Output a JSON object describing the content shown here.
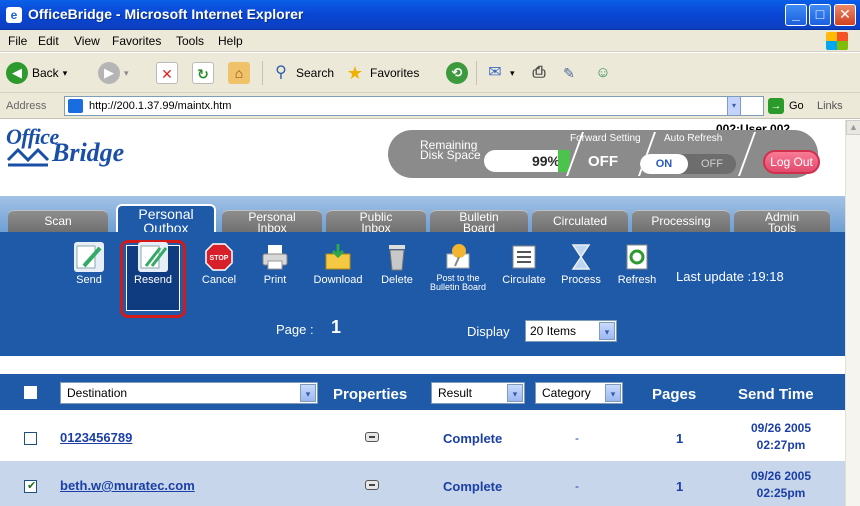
{
  "window": {
    "title": "OfficeBridge - Microsoft Internet Explorer",
    "min_glyph": "_",
    "max_glyph": "□",
    "close_glyph": "✕",
    "app_icon": "e"
  },
  "menu": {
    "items": [
      "File",
      "Edit",
      "View",
      "Favorites",
      "Tools",
      "Help"
    ]
  },
  "toolbar": {
    "back_label": "Back",
    "search_label": "Search",
    "favorites_label": "Favorites",
    "dropdown_glyph": "▾"
  },
  "address": {
    "label": "Address",
    "url": "http://200.1.37.99/maintx.htm",
    "go_label": "Go",
    "links_label": "Links"
  },
  "header": {
    "logo_office": "Office",
    "logo_bridge": "Bridge",
    "user": "002:User 002",
    "remaining_disk_space_label_1": "Remaining",
    "remaining_disk_space_label_2": "Disk Space",
    "disk_percent": "99%",
    "forward_setting_label": "Forward Setting",
    "forward_setting_value": "OFF",
    "auto_refresh_label": "Auto Refresh",
    "auto_refresh_on": "ON",
    "auto_refresh_off": "OFF",
    "logout_label": "Log Out"
  },
  "tabs": [
    {
      "line1": "Scan",
      "line2": ""
    },
    {
      "line1": "Personal",
      "line2": "Outbox"
    },
    {
      "line1": "Personal",
      "line2": "Inbox"
    },
    {
      "line1": "Public",
      "line2": "Inbox"
    },
    {
      "line1": "Bulletin",
      "line2": "Board"
    },
    {
      "line1": "Circulated",
      "line2": ""
    },
    {
      "line1": "Processing",
      "line2": ""
    },
    {
      "line1": "Admin",
      "line2": "Tools"
    }
  ],
  "actions": {
    "send": "Send",
    "resend": "Resend",
    "cancel": "Cancel",
    "cancel_icon": "STOP",
    "print": "Print",
    "download": "Download",
    "delete": "Delete",
    "post_line1": "Post to the",
    "post_line2": "Bulletin Board",
    "circulate": "Circulate",
    "process": "Process",
    "refresh": "Refresh",
    "last_update": "Last update :19:18"
  },
  "paging": {
    "page_label": "Page :",
    "page_value": "1",
    "display_label": "Display",
    "display_value": "20 Items"
  },
  "table": {
    "destination_select": "Destination",
    "properties_label": "Properties",
    "result_select": "Result",
    "category_select": "Category",
    "pages_label": "Pages",
    "send_time_label": "Send Time",
    "rows": [
      {
        "destination": "0123456789",
        "result": "Complete",
        "category": "-",
        "pages": "1",
        "date": "09/26 2005",
        "time": "02:27pm",
        "checked": false
      },
      {
        "destination": "beth.w@muratec.com",
        "result": "Complete",
        "category": "-",
        "pages": "1",
        "date": "09/26 2005",
        "time": "02:25pm",
        "checked": true
      }
    ]
  }
}
